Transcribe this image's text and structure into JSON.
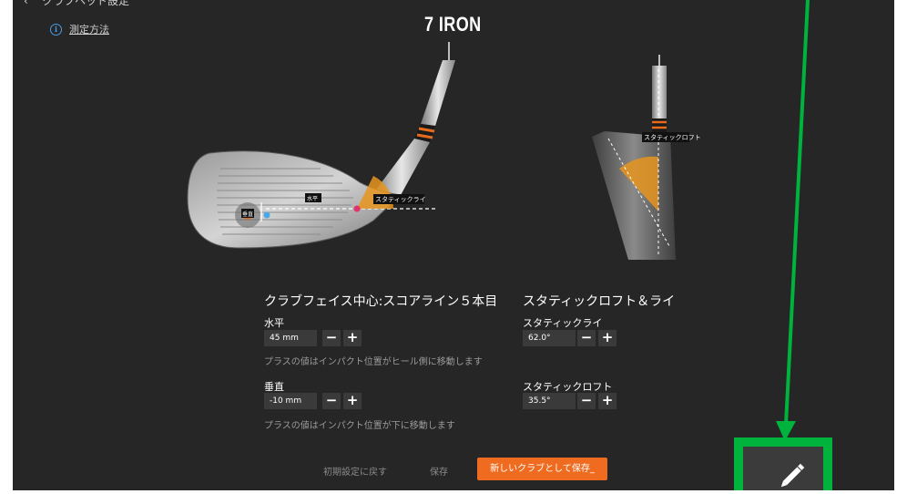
{
  "header": {
    "back_label": "クラブヘッド設定",
    "club_title": "7 IRON",
    "info_link_label": "測定方法"
  },
  "diagram": {
    "face_horizontal_label": "水平",
    "face_vertical_label": "垂直",
    "lie_label": "スタティックライ",
    "loft_label": "スタティックロフト"
  },
  "face_center": {
    "section_title": "クラブフェイス中心:スコアライン５本目",
    "horizontal": {
      "label": "水平",
      "value": "45 mm",
      "hint": "プラスの値はインパクト位置がヒール側に移動します"
    },
    "vertical": {
      "label": "垂直",
      "value": "-10 mm",
      "hint": "プラスの値はインパクト位置が下に移動します"
    }
  },
  "loft_lie": {
    "section_title": "スタティックロフト＆ライ",
    "lie": {
      "label": "スタティックライ",
      "value": "62.0°"
    },
    "loft": {
      "label": "スタティックロフト",
      "value": "35.5°"
    }
  },
  "controls": {
    "minus": "−",
    "plus": "+"
  },
  "footer": {
    "reset_label": "初期設定に戻す",
    "save_label": "保存",
    "save_new_label": "新しいクラブとして保存"
  },
  "annotation": {
    "color": "#00b33c"
  },
  "colors": {
    "accent": "#ef6b1f",
    "info": "#4a9ce8",
    "background": "#262626"
  }
}
